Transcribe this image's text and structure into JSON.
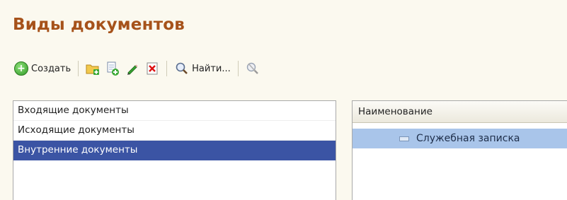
{
  "window": {
    "title": "Виды документов"
  },
  "toolbar": {
    "create_label": "Создать",
    "find_label": "Найти...",
    "icons": [
      "add-folder-icon",
      "copy-icon",
      "edit-pencil-icon",
      "delete-x-icon",
      "search-icon",
      "clear-search-icon"
    ]
  },
  "left_list": {
    "items": [
      {
        "label": "Входящие документы",
        "selected": false
      },
      {
        "label": "Исходящие документы",
        "selected": false
      },
      {
        "label": "Внутренние документы",
        "selected": true
      }
    ]
  },
  "table": {
    "column_header": "Наименование",
    "rows": [
      {
        "name": "Служебная записка",
        "selected": true
      }
    ]
  },
  "colors": {
    "title": "#a6521a",
    "selection_blue": "#3b54a4",
    "row_selection": "#a9c5ea",
    "background": "#fbf9ef"
  }
}
